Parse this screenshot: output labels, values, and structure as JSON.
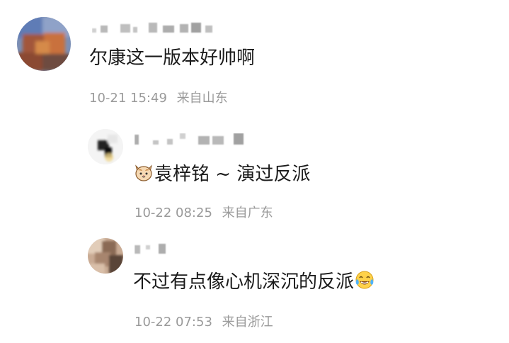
{
  "comments": [
    {
      "text": "尔康这一版本好帅啊",
      "time": "10-21 15:49",
      "location": "来自山东",
      "avatar_icon": "blurred-avatar"
    },
    {
      "text_after_emoji": "袁梓铭 ~ 演过反派",
      "emoji_icon": "cat-face-icon",
      "time": "10-22 08:25",
      "location": "来自广东",
      "avatar_icon": "blurred-avatar"
    },
    {
      "text": "不过有点像心机深沉的反派",
      "emoji_icon": "tears-of-joy-icon",
      "time": "10-22 07:53",
      "location": "来自浙江",
      "avatar_icon": "blurred-avatar"
    }
  ]
}
